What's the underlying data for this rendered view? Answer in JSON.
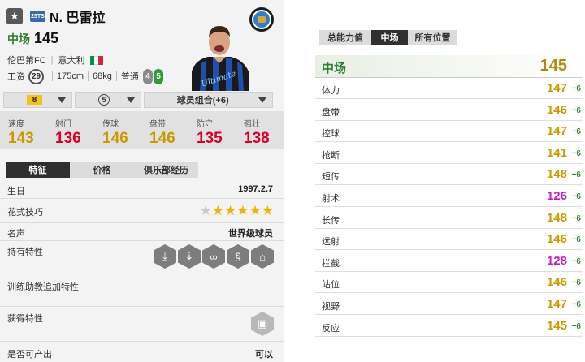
{
  "header": {
    "season": "25TS",
    "name": "N. 巴雷拉",
    "position": "中场",
    "rating": "145",
    "club": "伦巴第FC",
    "nation": "意大利",
    "flag_colors": [
      "#009246",
      "#ffffff",
      "#ce2b37"
    ],
    "wage_label": "工资",
    "wage": "29",
    "height": "175cm",
    "weight": "68kg",
    "body_type": "普通",
    "weak_foot": "4",
    "skill_moves": "5"
  },
  "selectors": {
    "level": "8",
    "enhance": "5",
    "team_color": "球员组合(+6)"
  },
  "stats": [
    {
      "label": "速度",
      "value": "143",
      "color": "#c99a00"
    },
    {
      "label": "射门",
      "value": "136",
      "color": "#d4002a"
    },
    {
      "label": "传球",
      "value": "146",
      "color": "#c99a00"
    },
    {
      "label": "盘带",
      "value": "146",
      "color": "#c99a00"
    },
    {
      "label": "防守",
      "value": "135",
      "color": "#d4002a"
    },
    {
      "label": "强壮",
      "value": "138",
      "color": "#d4002a"
    }
  ],
  "info_tabs": [
    "特征",
    "价格",
    "俱乐部经历"
  ],
  "details": {
    "birthday_label": "生日",
    "birthday": "1997.2.7",
    "skill_label": "花式技巧",
    "skill_stars": 5,
    "fame_label": "名声",
    "fame": "世界级球员",
    "traits_label": "持有特性",
    "trait_icons": [
      "power-shot-icon",
      "chip-shot-icon",
      "through-pass-icon",
      "dribbler-icon",
      "playmaker-icon"
    ],
    "training_label": "训练助教追加特性",
    "acquired_label": "获得特性",
    "tradable_label": "是否可产出",
    "tradable": "可以"
  },
  "right_tabs": [
    "总能力值",
    "中场",
    "所有位置"
  ],
  "position_block": {
    "label": "中场",
    "value": "145"
  },
  "attributes": [
    {
      "label": "体力",
      "value": "147",
      "bonus": "+6",
      "color": "#c99a00"
    },
    {
      "label": "盘带",
      "value": "146",
      "bonus": "+6",
      "color": "#c99a00"
    },
    {
      "label": "控球",
      "value": "147",
      "bonus": "+6",
      "color": "#c99a00"
    },
    {
      "label": "抢断",
      "value": "141",
      "bonus": "+6",
      "color": "#c99a00"
    },
    {
      "label": "短传",
      "value": "148",
      "bonus": "+6",
      "color": "#c99a00"
    },
    {
      "label": "射术",
      "value": "126",
      "bonus": "+6",
      "color": "#c21fc2"
    },
    {
      "label": "长传",
      "value": "148",
      "bonus": "+6",
      "color": "#c99a00"
    },
    {
      "label": "远射",
      "value": "146",
      "bonus": "+6",
      "color": "#c99a00"
    },
    {
      "label": "拦截",
      "value": "128",
      "bonus": "+6",
      "color": "#c21fc2"
    },
    {
      "label": "站位",
      "value": "146",
      "bonus": "+6",
      "color": "#c99a00"
    },
    {
      "label": "视野",
      "value": "147",
      "bonus": "+6",
      "color": "#c99a00"
    },
    {
      "label": "反应",
      "value": "145",
      "bonus": "+6",
      "color": "#c99a00"
    }
  ]
}
